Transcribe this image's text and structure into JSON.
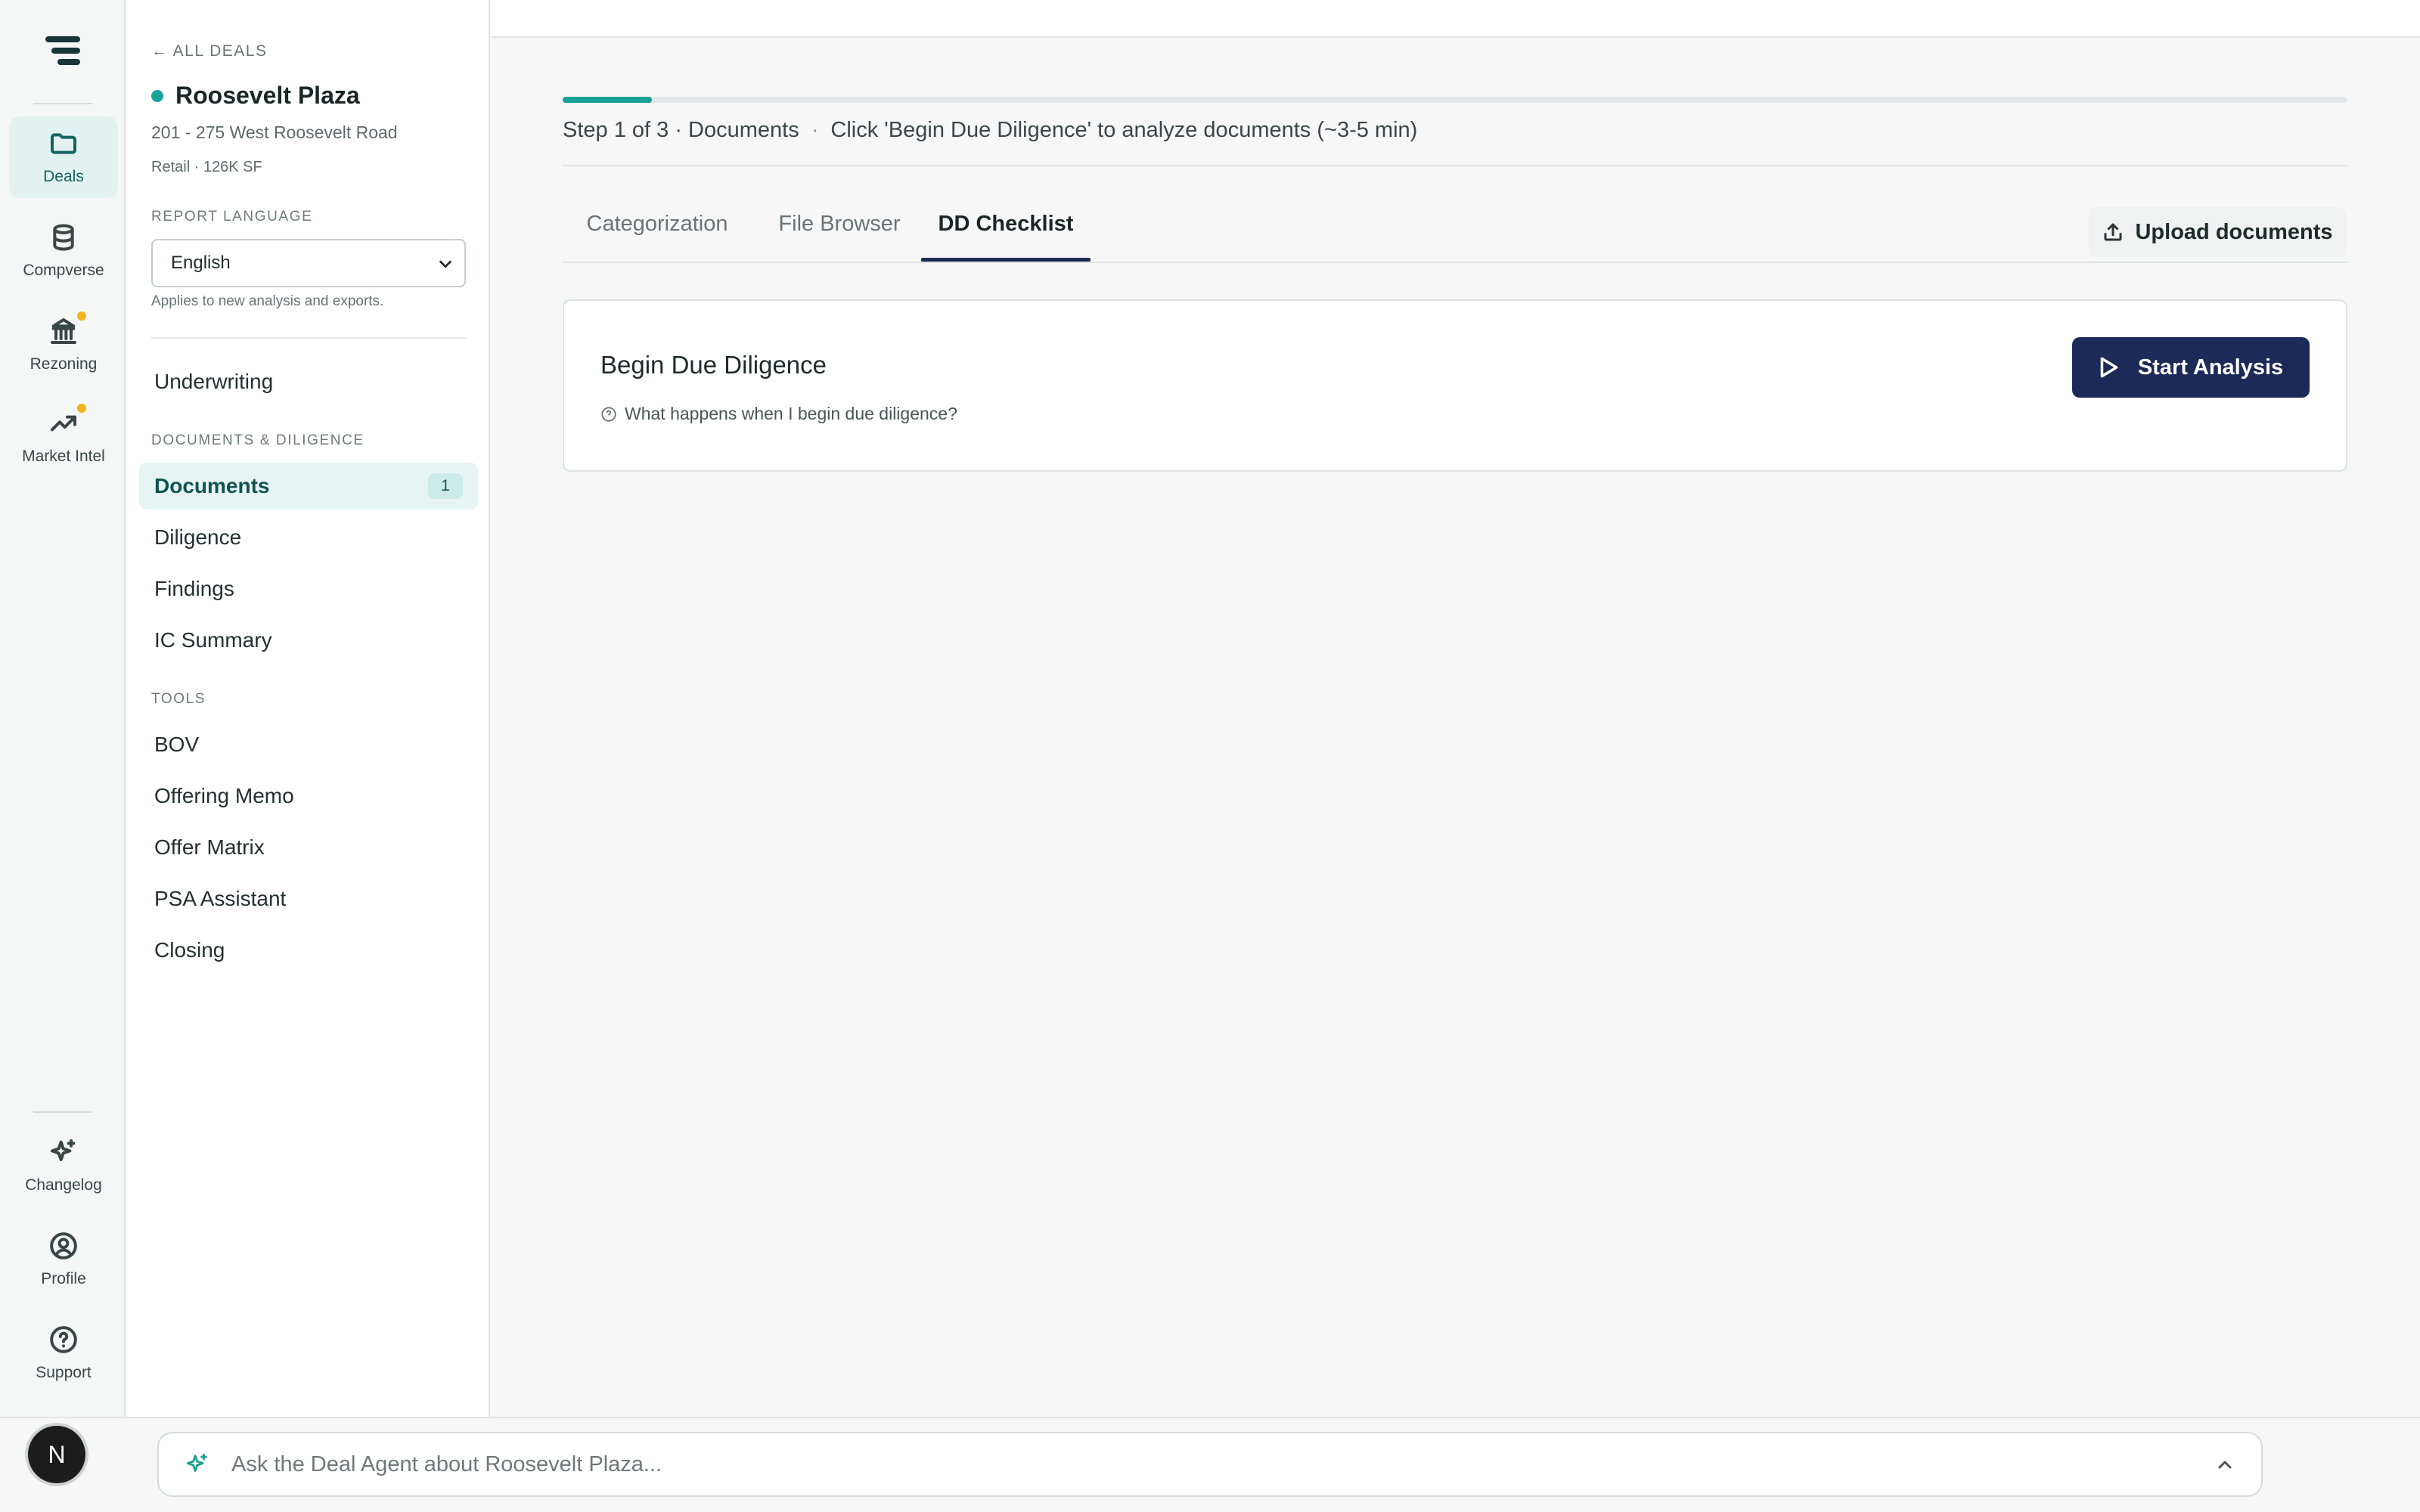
{
  "rail": {
    "items": [
      {
        "label": "Deals",
        "icon": "folder-icon",
        "active": true
      },
      {
        "label": "Compverse",
        "icon": "database-icon"
      },
      {
        "label": "Rezoning",
        "icon": "landmark-icon",
        "badge": true
      },
      {
        "label": "Market Intel",
        "icon": "trending-up-icon",
        "badge": true
      }
    ],
    "bottom_items": [
      {
        "label": "Changelog",
        "icon": "sparkles-icon"
      },
      {
        "label": "Profile",
        "icon": "user-circle-icon"
      },
      {
        "label": "Support",
        "icon": "help-circle-icon"
      }
    ],
    "avatar_initial": "N"
  },
  "deal": {
    "back_label": "← ALL DEALS",
    "name": "Roosevelt Plaza",
    "address": "201 - 275 West Roosevelt Road",
    "meta": "Retail · 126K SF",
    "status_color": "#1aa39a"
  },
  "report_language": {
    "label": "REPORT LANGUAGE",
    "selected": "English",
    "note": "Applies to new analysis and exports."
  },
  "sidebar": {
    "top_item": "Underwriting",
    "docs_section_label": "DOCUMENTS & DILIGENCE",
    "docs_items": [
      {
        "label": "Documents",
        "badge": "1",
        "active": true
      },
      {
        "label": "Diligence"
      },
      {
        "label": "Findings"
      },
      {
        "label": "IC Summary"
      }
    ],
    "tools_section_label": "TOOLS",
    "tools_items": [
      {
        "label": "BOV"
      },
      {
        "label": "Offering Memo"
      },
      {
        "label": "Offer Matrix"
      },
      {
        "label": "PSA Assistant"
      },
      {
        "label": "Closing"
      }
    ]
  },
  "progress": {
    "fraction": 0.05,
    "step_text": "Step 1 of 3 · Documents",
    "separator": "·",
    "hint": "Click 'Begin Due Diligence' to analyze documents (~3-5 min)"
  },
  "tabs": [
    {
      "label": "Categorization"
    },
    {
      "label": "File Browser"
    },
    {
      "label": "DD Checklist",
      "active": true
    }
  ],
  "upload_button": "Upload documents",
  "dd_card": {
    "title": "Begin Due Diligence",
    "help": "What happens when I begin due diligence?",
    "start_button": "Start Analysis"
  },
  "agent": {
    "placeholder": "Ask the Deal Agent about Roosevelt Plaza..."
  },
  "colors": {
    "accent": "#19a095",
    "primary_button": "#1b2a57",
    "badge_dot": "#f0b41c"
  }
}
